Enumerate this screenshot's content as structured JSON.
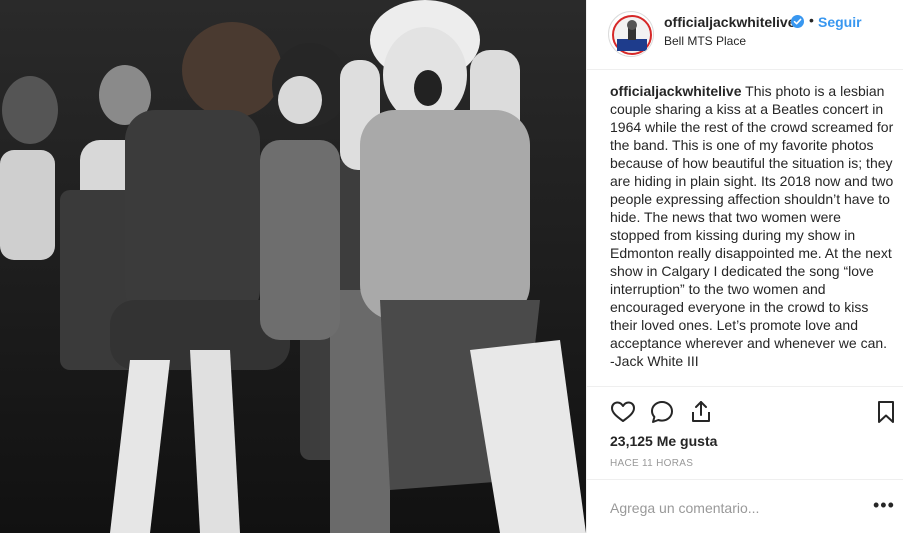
{
  "post": {
    "image_alt": "Black and white photo of fans at a 1964 concert",
    "author": {
      "username": "officialjackwhitelive",
      "verified": true,
      "location": "Bell MTS Place"
    },
    "header": {
      "dot": "•",
      "follow_label": "Seguir"
    },
    "caption": {
      "username": "officialjackwhitelive",
      "text": "This photo is a lesbian couple sharing a kiss at a Beatles concert in 1964 while the rest of the crowd screamed for the band. This is one of my favorite photos because of how beautiful the situation is; they are hiding in plain sight. Its 2018 now and two people expressing affection shouldn’t have to hide. The news that two women were stopped from kissing during my show in Edmonton really disappointed me. At the next show in Calgary I dedicated the song “love interruption” to the two women and encouraged everyone in the crowd to kiss their loved ones. Let’s promote love and acceptance wherever and whenever we can. -Jack White III"
    },
    "likes_text": "23,125 Me gusta",
    "timestamp": "HACE 11 HORAS",
    "comment": {
      "placeholder": "Agrega un comentario...",
      "more_label": "•••"
    },
    "icons": [
      "heart-icon",
      "comment-icon",
      "share-icon",
      "bookmark-icon",
      "verified-badge-icon"
    ],
    "colors": {
      "accent": "#3897f0",
      "text": "#262626",
      "muted": "#999999",
      "border": "#efefef"
    }
  }
}
